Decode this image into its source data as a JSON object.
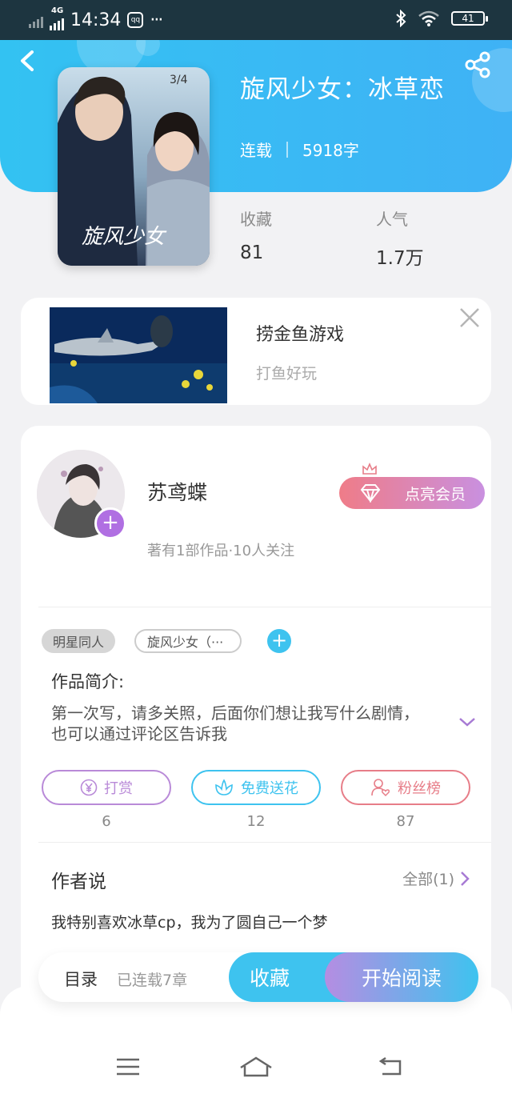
{
  "status_bar": {
    "network": "4G",
    "time": "14:34",
    "app_badge": "qq",
    "more": "···",
    "battery": "41"
  },
  "book": {
    "title": "旋风少女：冰草恋",
    "status": "连载",
    "word_count": "5918字",
    "stats": [
      {
        "label": "收藏",
        "value": "81"
      },
      {
        "label": "人气",
        "value": "1.7万"
      }
    ],
    "cover_icon": "book-cover-image"
  },
  "ad": {
    "title": "捞金鱼游戏",
    "subtitle": "打鱼好玩",
    "image_icon": "ad-underwater-image"
  },
  "author": {
    "name": "苏鸢蝶",
    "info": "著有1部作品·10人关注",
    "vip_button": "点亮会员"
  },
  "tags": [
    "明星同人",
    "旋风少女（···"
  ],
  "intro": {
    "title": "作品简介:",
    "text": "第一次写，请多关照，后面你们想让我写什么剧情，也可以通过评论区告诉我"
  },
  "actions": [
    {
      "label": "打赏",
      "count": "6",
      "color": "#b98ad8"
    },
    {
      "label": "免费送花",
      "count": "12",
      "color": "#3ec3ef"
    },
    {
      "label": "粉丝榜",
      "count": "87",
      "color": "#e77d88"
    }
  ],
  "author_says": {
    "title": "作者说",
    "all_label": "全部(1)",
    "text": "我特别喜欢冰草cp，我为了圆自己一个梦"
  },
  "bottom_bar": {
    "toc": "目录",
    "chapters": "已连载7章",
    "favorite": "收藏",
    "read": "开始阅读"
  },
  "colors": {
    "header": "#36bdf3",
    "accent_blue": "#3ec3ef",
    "accent_purple": "#b98ad8",
    "accent_pink": "#e77d88"
  }
}
